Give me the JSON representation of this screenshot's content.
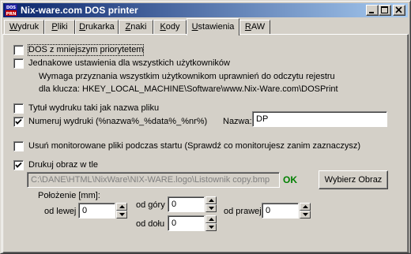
{
  "window": {
    "title": "Nix-ware.com DOS printer",
    "icon_text": "DOS PRN"
  },
  "tabs": [
    {
      "label": "Wydruk",
      "accel": "W",
      "rest": "ydruk"
    },
    {
      "label": "Pliki",
      "accel": "P",
      "rest": "liki"
    },
    {
      "label": "Drukarka",
      "accel": "D",
      "rest": "rukarka"
    },
    {
      "label": "Znaki",
      "accel": "Z",
      "rest": "naki"
    },
    {
      "label": "Kody",
      "accel": "K",
      "rest": "ody"
    },
    {
      "label": "Ustawienia",
      "accel": "U",
      "rest": "stawienia",
      "active": true
    },
    {
      "label": "RAW",
      "accel": "R",
      "rest": "AW"
    }
  ],
  "settings": {
    "dos_low_priority": {
      "label": "DOS z mniejszym priorytetem",
      "checked": false
    },
    "same_settings": {
      "label": "Jednakowe ustawienia dla wszystkich użytkowników",
      "checked": false
    },
    "note_line1": "Wymaga przyznania wszystkim użytkownikom uprawnień do odczytu rejestru",
    "note_line2": "dla klucza: HKEY_LOCAL_MACHINE\\Software\\www.Nix-Ware.com\\DOSPrint",
    "title_as_filename": {
      "label": "Tytuł wydruku taki jak nazwa pliku",
      "checked": false
    },
    "number_printouts": {
      "label": "Numeruj wydruki (%nazwa%_%data%_%nr%)",
      "checked": true
    },
    "name_label": "Nazwa:",
    "name_value": "DP",
    "remove_monitored": {
      "label": "Usuń monitorowane pliki podczas startu (Sprawdź co monitorujesz zanim zaznaczysz)",
      "checked": false
    },
    "print_background": {
      "label": "Drukuj obraz w tle",
      "checked": true
    },
    "image_path": "C:\\DANE\\HTML\\NixWare\\NIX-WARE.logo\\Listownik copy.bmp",
    "ok_text": "OK",
    "choose_image_button": "Wybierz Obraz",
    "position_label": "Położenie [mm]:",
    "left_label": "od lewej",
    "left_value": "0",
    "top_label": "od góry",
    "top_value": "0",
    "bottom_label": "od dołu",
    "bottom_value": "0",
    "right_label": "od prawej",
    "right_value": "0"
  },
  "colors": {
    "titlebar_start": "#0a246a",
    "titlebar_end": "#a6caf0",
    "face": "#d4d0c8",
    "ok_green": "#008000"
  }
}
